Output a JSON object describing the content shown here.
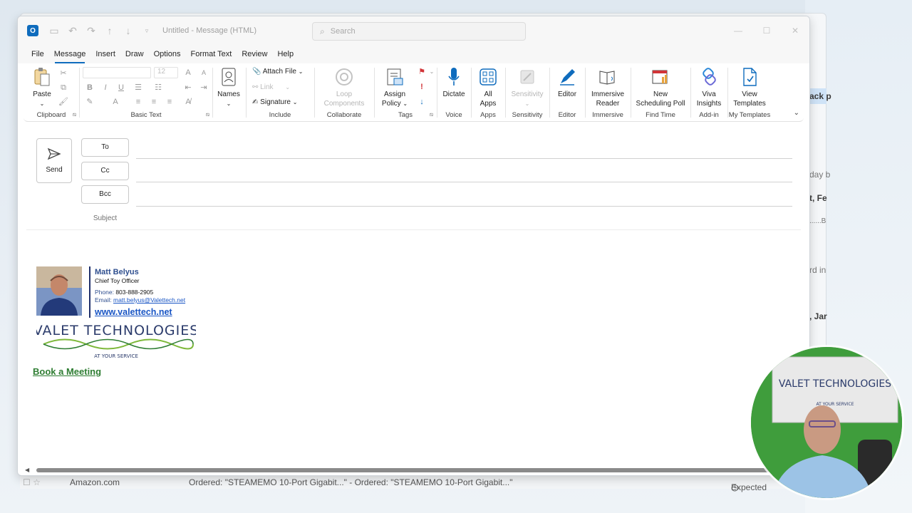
{
  "window": {
    "doc_title": "Untitled  -  Message (HTML)",
    "search_placeholder": "Search"
  },
  "menu": [
    "File",
    "Message",
    "Insert",
    "Draw",
    "Options",
    "Format Text",
    "Review",
    "Help"
  ],
  "active_tab": "Message",
  "ribbon": {
    "clipboard": {
      "paste": "Paste",
      "label": "Clipboard"
    },
    "basic_text": {
      "font_size": "12",
      "label": "Basic Text"
    },
    "names": {
      "btn": "Names"
    },
    "include": {
      "attach": "Attach File",
      "link": "Link",
      "signature": "Signature",
      "label": "Include"
    },
    "collaborate": {
      "loop1": "Loop",
      "loop2": "Components",
      "label": "Collaborate"
    },
    "tags": {
      "assign1": "Assign",
      "assign2": "Policy",
      "label": "Tags"
    },
    "voice": {
      "dictate": "Dictate",
      "label": "Voice"
    },
    "apps": {
      "all1": "All",
      "all2": "Apps",
      "label": "Apps"
    },
    "sensitivity": {
      "btn": "Sensitivity",
      "label": "Sensitivity"
    },
    "editor": {
      "btn": "Editor",
      "label": "Editor"
    },
    "immersive": {
      "btn1": "Immersive",
      "btn2": "Reader",
      "label": "Immersive"
    },
    "find_time": {
      "btn1": "New",
      "btn2": "Scheduling Poll",
      "label": "Find Time"
    },
    "addin": {
      "btn1": "Viva",
      "btn2": "Insights",
      "label": "Add-in"
    },
    "templates": {
      "btn1": "View",
      "btn2": "Templates",
      "label": "My Templates"
    }
  },
  "compose": {
    "send": "Send",
    "to": "To",
    "cc": "Cc",
    "bcc": "Bcc",
    "subject": "Subject"
  },
  "signature": {
    "name": "Matt Belyus",
    "title": "Chief Toy Officer",
    "phone_label": "Phone:",
    "phone": "803-888-2905",
    "email_label": "Email:",
    "email": "matt.belyus@Valettech.net",
    "website": "www.valettech.net",
    "logo_text": "VALET TECHNOLOGIES",
    "logo_tagline": "AT YOUR SERVICE",
    "book_meeting": "Book a Meeting"
  },
  "background": {
    "snippets": [
      "ack p",
      "day b",
      "t, Fe",
      "......B",
      "rd in",
      ", Jar"
    ],
    "bottom_sender": "Amazon.com",
    "bottom_subject": "Ordered: \"STEAMEMO 10-Port Gigabit...\" - Ordered: \"STEAMEMO 10-Port Gigabit...\"",
    "bottom_right": "Expected"
  },
  "webcam": {
    "banner_text": "VALET TECHNOLOGIES",
    "banner_tagline": "AT YOUR SERVICE"
  },
  "colors": {
    "accent": "#0f6cbd",
    "book_link": "#2e7d32",
    "sig_blue": "#2f4f8f"
  }
}
